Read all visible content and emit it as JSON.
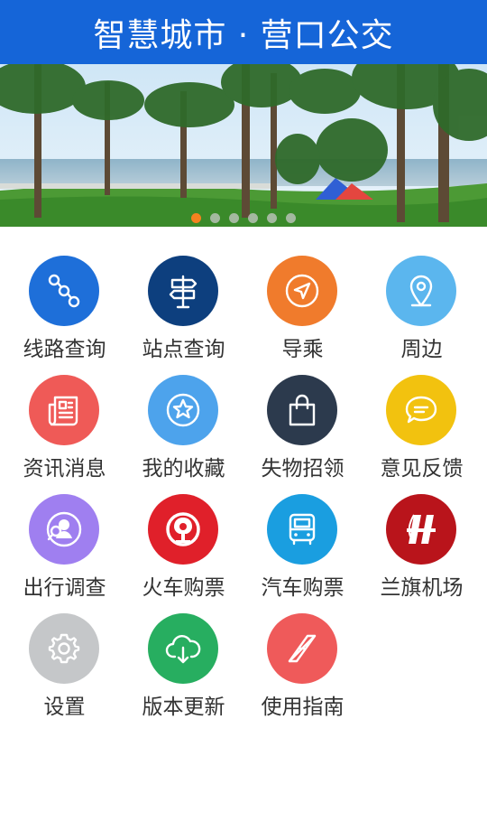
{
  "header": {
    "title": "智慧城市 · 营口公交"
  },
  "banner": {
    "slides": 6,
    "active_index": 0
  },
  "menu": [
    {
      "label": "线路查询",
      "icon": "route-icon",
      "color": "#1e6fd9"
    },
    {
      "label": "站点查询",
      "icon": "signpost-icon",
      "color": "#0d3f7e"
    },
    {
      "label": "导乘",
      "icon": "navigation-icon",
      "color": "#f07b2c"
    },
    {
      "label": "周边",
      "icon": "location-pin-icon",
      "color": "#5bb6ee"
    },
    {
      "label": "资讯消息",
      "icon": "newspaper-icon",
      "color": "#ef5a57"
    },
    {
      "label": "我的收藏",
      "icon": "star-icon",
      "color": "#4da3ec"
    },
    {
      "label": "失物招领",
      "icon": "shopping-bag-icon",
      "color": "#2c3a4d"
    },
    {
      "label": "意见反馈",
      "icon": "chat-bubble-icon",
      "color": "#f2c20f"
    },
    {
      "label": "出行调查",
      "icon": "survey-icon",
      "color": "#9f7ff0"
    },
    {
      "label": "火车购票",
      "icon": "railway-logo-icon",
      "color": "#e0202a"
    },
    {
      "label": "汽车购票",
      "icon": "bus-icon",
      "color": "#1a9ee0"
    },
    {
      "label": "兰旗机场",
      "icon": "airport-logo-icon",
      "color": "#b9141b"
    },
    {
      "label": "设置",
      "icon": "gear-icon",
      "color": "#c5c7c9"
    },
    {
      "label": "版本更新",
      "icon": "cloud-download-icon",
      "color": "#27ae60"
    },
    {
      "label": "使用指南",
      "icon": "compass-icon",
      "color": "#ef5a5a"
    }
  ]
}
